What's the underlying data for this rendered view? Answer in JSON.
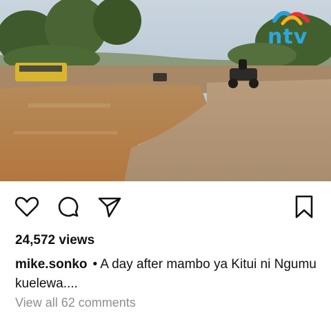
{
  "post": {
    "media": {
      "watermark_text": "ntv",
      "watermark_icon": "ntv-logo-icon"
    },
    "actions": {
      "like_icon": "heart-icon",
      "comment_icon": "comment-icon",
      "share_icon": "send-icon",
      "save_icon": "bookmark-icon"
    },
    "views": "24,572 views",
    "caption": {
      "username": "mike.sonko",
      "separator": "•",
      "text": "A day after mambo ya Kitui ni Ngumu kuelewa...."
    },
    "comments_link": "View all 62 comments"
  },
  "colors": {
    "text": "#111111",
    "muted": "#8e8e8e",
    "background": "#ffffff"
  }
}
